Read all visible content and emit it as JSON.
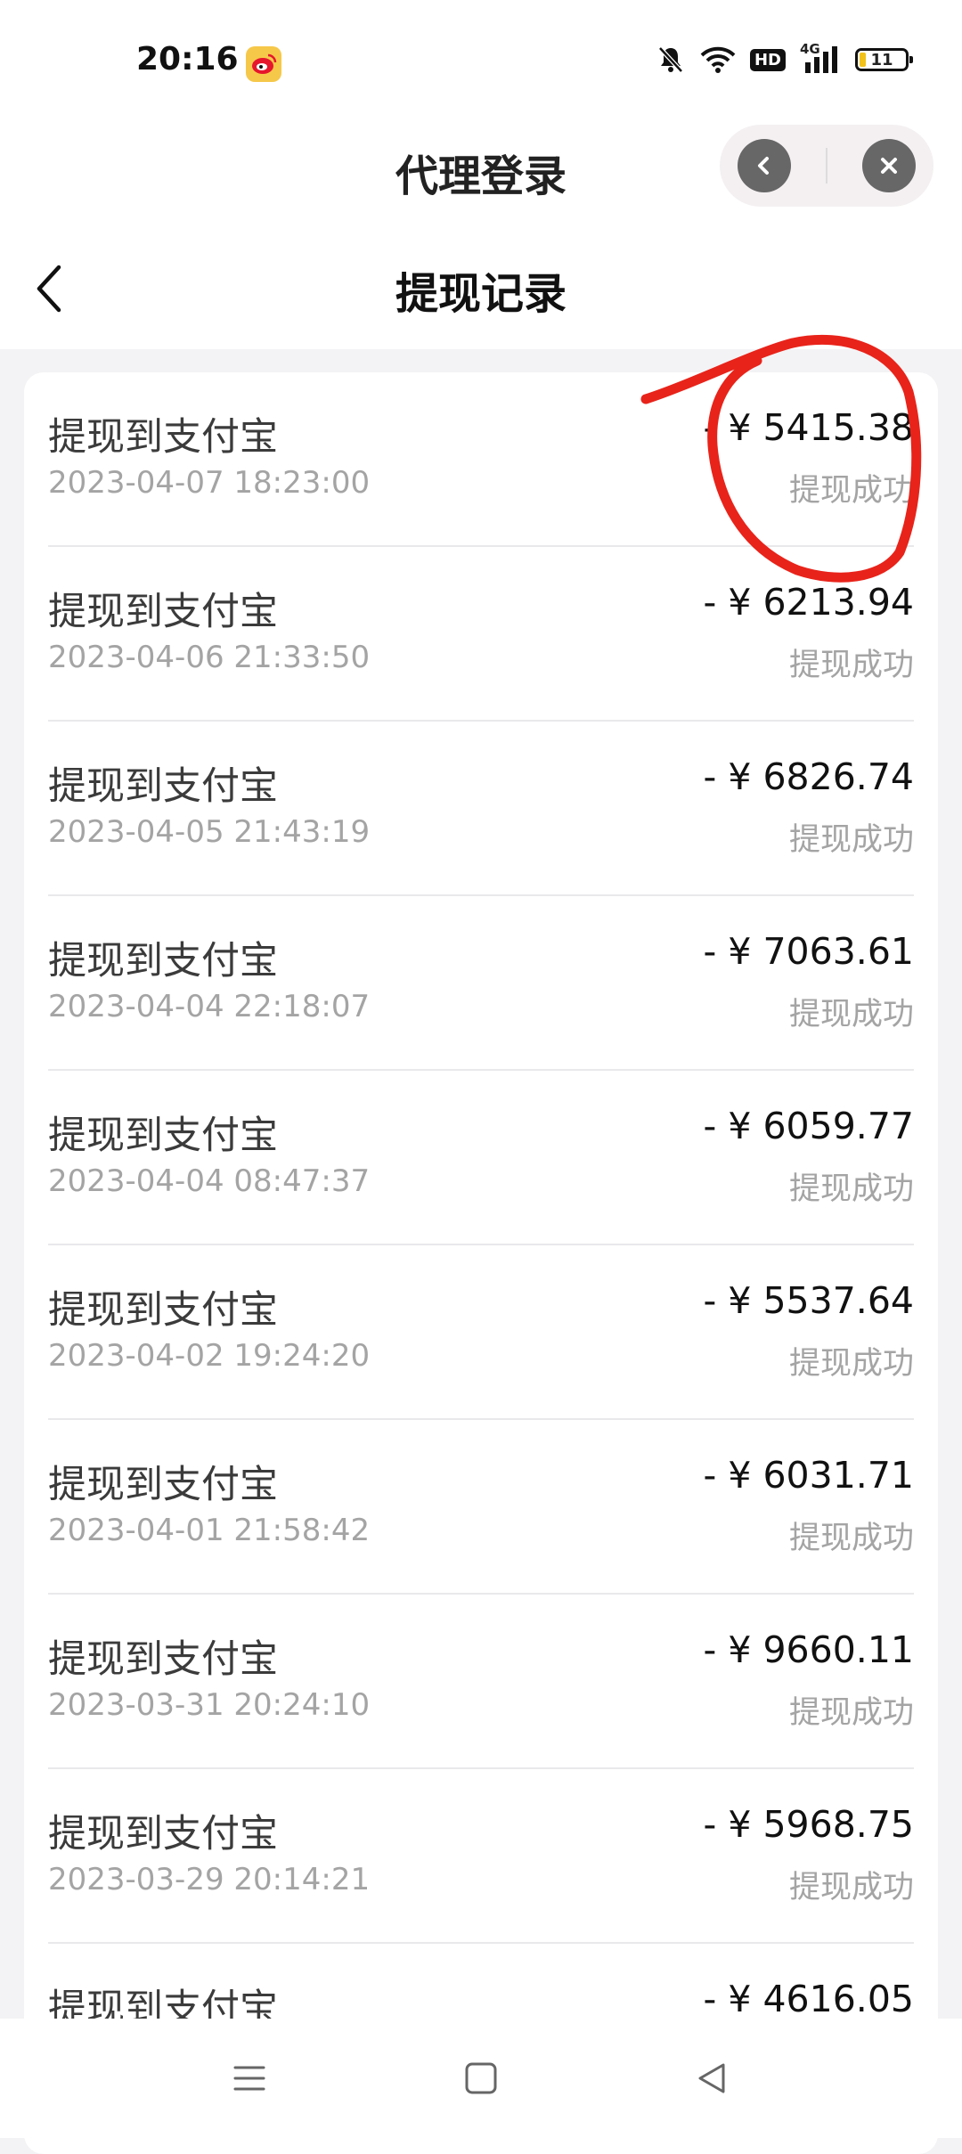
{
  "status_bar": {
    "time": "20:16",
    "app_icon": "weibo-icon",
    "icons": [
      "mute-bell-icon",
      "wifi-icon",
      "hd-icon",
      "4g-signal-icon",
      "battery-icon"
    ],
    "hd_label": "HD",
    "network_label": "4G",
    "battery_level": "11"
  },
  "mini_program": {
    "title": "代理登录",
    "capsule_icons": [
      "back-circle-icon",
      "close-circle-icon"
    ]
  },
  "nav": {
    "title": "提现记录",
    "back_icon": "chevron-left-icon"
  },
  "records": [
    {
      "title": "提现到支付宝",
      "time": "2023-04-07 18:23:00",
      "amount": "- ¥ 5415.38",
      "status": "提现成功"
    },
    {
      "title": "提现到支付宝",
      "time": "2023-04-06 21:33:50",
      "amount": "- ¥ 6213.94",
      "status": "提现成功"
    },
    {
      "title": "提现到支付宝",
      "time": "2023-04-05 21:43:19",
      "amount": "- ¥ 6826.74",
      "status": "提现成功"
    },
    {
      "title": "提现到支付宝",
      "time": "2023-04-04 22:18:07",
      "amount": "- ¥ 7063.61",
      "status": "提现成功"
    },
    {
      "title": "提现到支付宝",
      "time": "2023-04-04 08:47:37",
      "amount": "- ¥ 6059.77",
      "status": "提现成功"
    },
    {
      "title": "提现到支付宝",
      "time": "2023-04-02 19:24:20",
      "amount": "- ¥ 5537.64",
      "status": "提现成功"
    },
    {
      "title": "提现到支付宝",
      "time": "2023-04-01 21:58:42",
      "amount": "- ¥ 6031.71",
      "status": "提现成功"
    },
    {
      "title": "提现到支付宝",
      "time": "2023-03-31 20:24:10",
      "amount": "- ¥ 9660.11",
      "status": "提现成功"
    },
    {
      "title": "提现到支付宝",
      "time": "2023-03-29 20:14:21",
      "amount": "- ¥ 5968.75",
      "status": "提现成功"
    },
    {
      "title": "提现到支付宝",
      "time": "",
      "amount": "- ¥ 4616.05",
      "status": ""
    }
  ],
  "annotation": {
    "color": "#e8231a"
  },
  "system_nav": {
    "icons": [
      "menu-icon",
      "home-square-icon",
      "back-triangle-icon"
    ]
  }
}
